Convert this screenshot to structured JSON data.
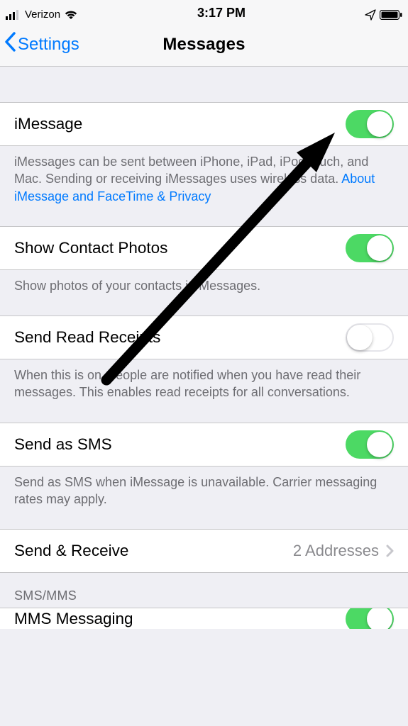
{
  "status": {
    "carrier": "Verizon",
    "time": "3:17 PM"
  },
  "nav": {
    "back": "Settings",
    "title": "Messages"
  },
  "rows": {
    "imessage": {
      "label": "iMessage",
      "on": true
    },
    "imessage_footer": {
      "text": "iMessages can be sent between iPhone, iPad, iPod touch, and Mac. Sending or receiving iMessages uses wireless data. ",
      "link": "About iMessage and FaceTime & Privacy"
    },
    "contact_photos": {
      "label": "Show Contact Photos",
      "on": true
    },
    "contact_photos_footer": "Show photos of your contacts in Messages.",
    "read_receipts": {
      "label": "Send Read Receipts",
      "on": false
    },
    "read_receipts_footer": "When this is on, people are notified when you have read their messages. This enables read receipts for all conversations.",
    "send_sms": {
      "label": "Send as SMS",
      "on": true
    },
    "send_sms_footer": "Send as SMS when iMessage is unavailable. Carrier messaging rates may apply.",
    "send_receive": {
      "label": "Send & Receive",
      "detail": "2 Addresses"
    },
    "sms_header": "SMS/MMS",
    "mms": {
      "label": "MMS Messaging",
      "on": true
    }
  }
}
